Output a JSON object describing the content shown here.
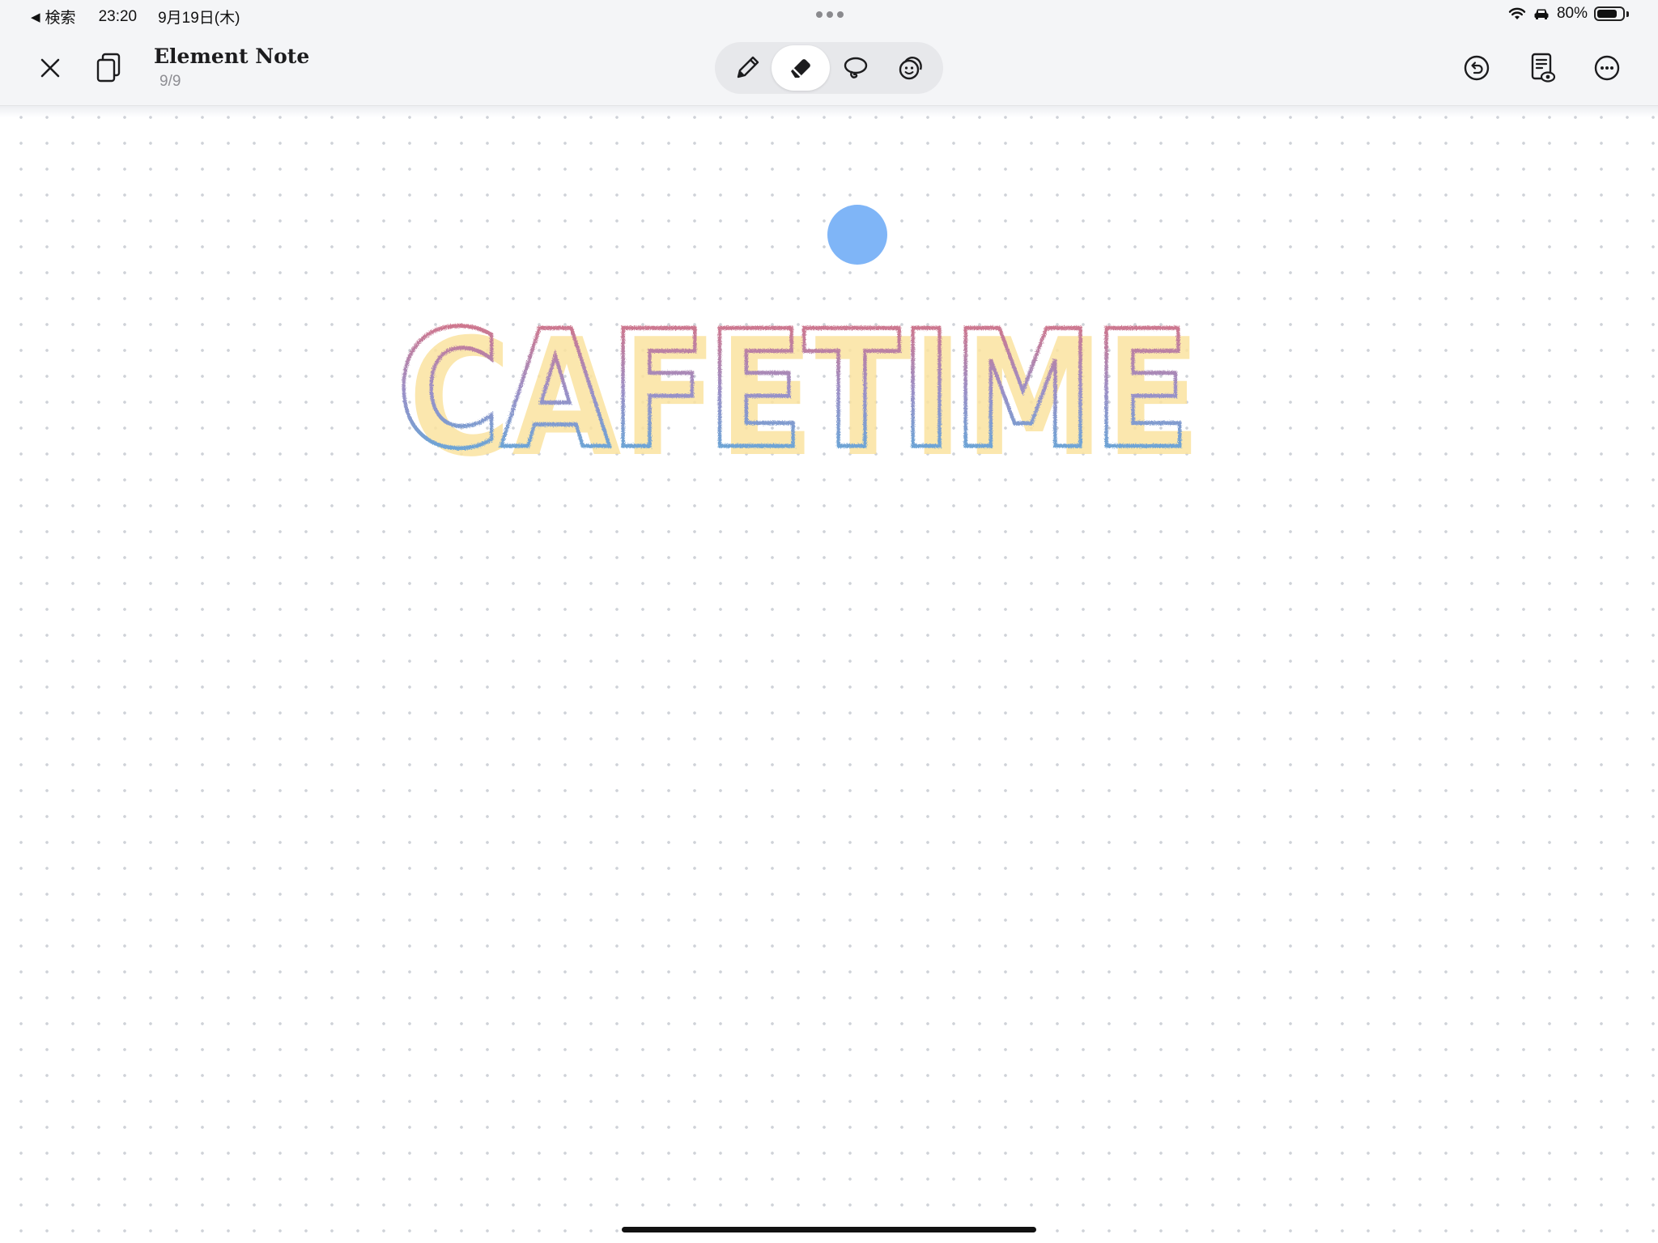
{
  "status_bar": {
    "back_label": "検索",
    "time": "23:20",
    "date": "9月19日(木)",
    "battery": "80%",
    "battery_level": 0.8
  },
  "toolbar": {
    "title": "Element Note",
    "page_indicator": "9/9",
    "tools": [
      {
        "icon": "pencil-icon",
        "active": false
      },
      {
        "icon": "eraser-icon",
        "active": true
      },
      {
        "icon": "lasso-icon",
        "active": false
      },
      {
        "icon": "sticker-icon",
        "active": false
      }
    ],
    "right_buttons": [
      "undo-icon",
      "page-view-icon",
      "more-icon"
    ]
  },
  "canvas": {
    "background": "dot-grid",
    "drawing_text": "CAFETIME",
    "colors": {
      "outline_top": "#e56b74",
      "outline_mid": "#9b8fc6",
      "outline_bottom": "#4fb2e0",
      "fill": "#fbe3a0",
      "cursor": "#7fb5f7"
    }
  }
}
